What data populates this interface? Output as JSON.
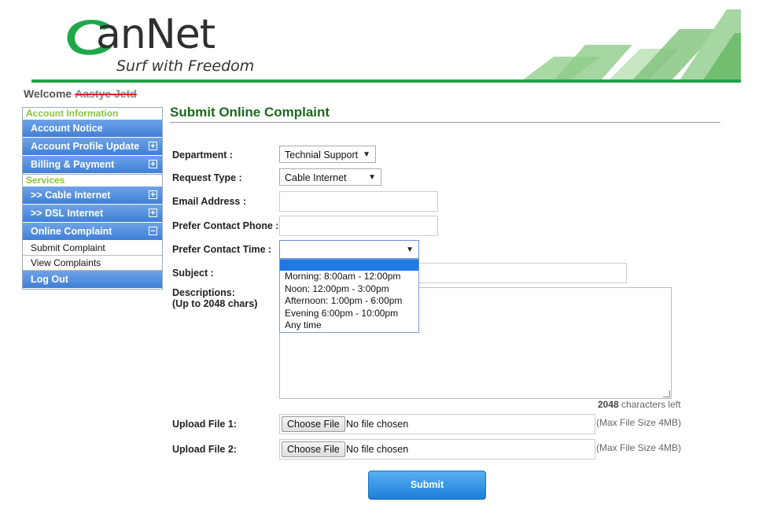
{
  "brand": {
    "logo_text": "anNet",
    "tagline": "Surf with Freedom",
    "accent": "#21a249"
  },
  "welcome": {
    "label": "Welcome",
    "name": "Aastye Jetd"
  },
  "sidebar": {
    "account_head": "Account Information",
    "items_account": [
      "Account Notice",
      "Account Profile Update",
      "Billing & Payment"
    ],
    "services_head": "Services",
    "items_services": [
      ">> Cable Internet",
      ">> DSL Internet",
      "Online Complaint"
    ],
    "sub_items": [
      "Submit Complaint",
      "View Complaints"
    ],
    "logout": "Log Out"
  },
  "form": {
    "title": "Submit Online Complaint",
    "department_label": "Department :",
    "department_value": "Technial Support",
    "request_type_label": "Request Type :",
    "request_type_value": "Cable Internet",
    "email_label": "Email Address :",
    "phone_label": "Prefer Contact Phone :",
    "contact_time_label": "Prefer Contact Time :",
    "contact_time_value": "",
    "contact_time_options": [
      "Morning: 8:00am - 12:00pm",
      "Noon: 12:00pm - 3:00pm",
      "Afternoon: 1:00pm - 6:00pm",
      "Evening 6:00pm - 10:00pm",
      "Any time"
    ],
    "subject_label": "Subject :",
    "descriptions_label": "Descriptions:",
    "descriptions_hint": "(Up to 2048 chars)",
    "chars_left_count": "2048",
    "chars_left_text": "characters left",
    "upload1_label": "Upload File 1:",
    "upload2_label": "Upload File 2:",
    "choose_file": "Choose File",
    "no_file": "No file chosen",
    "max_size": "(Max File Size 4MB)",
    "submit": "Submit"
  }
}
